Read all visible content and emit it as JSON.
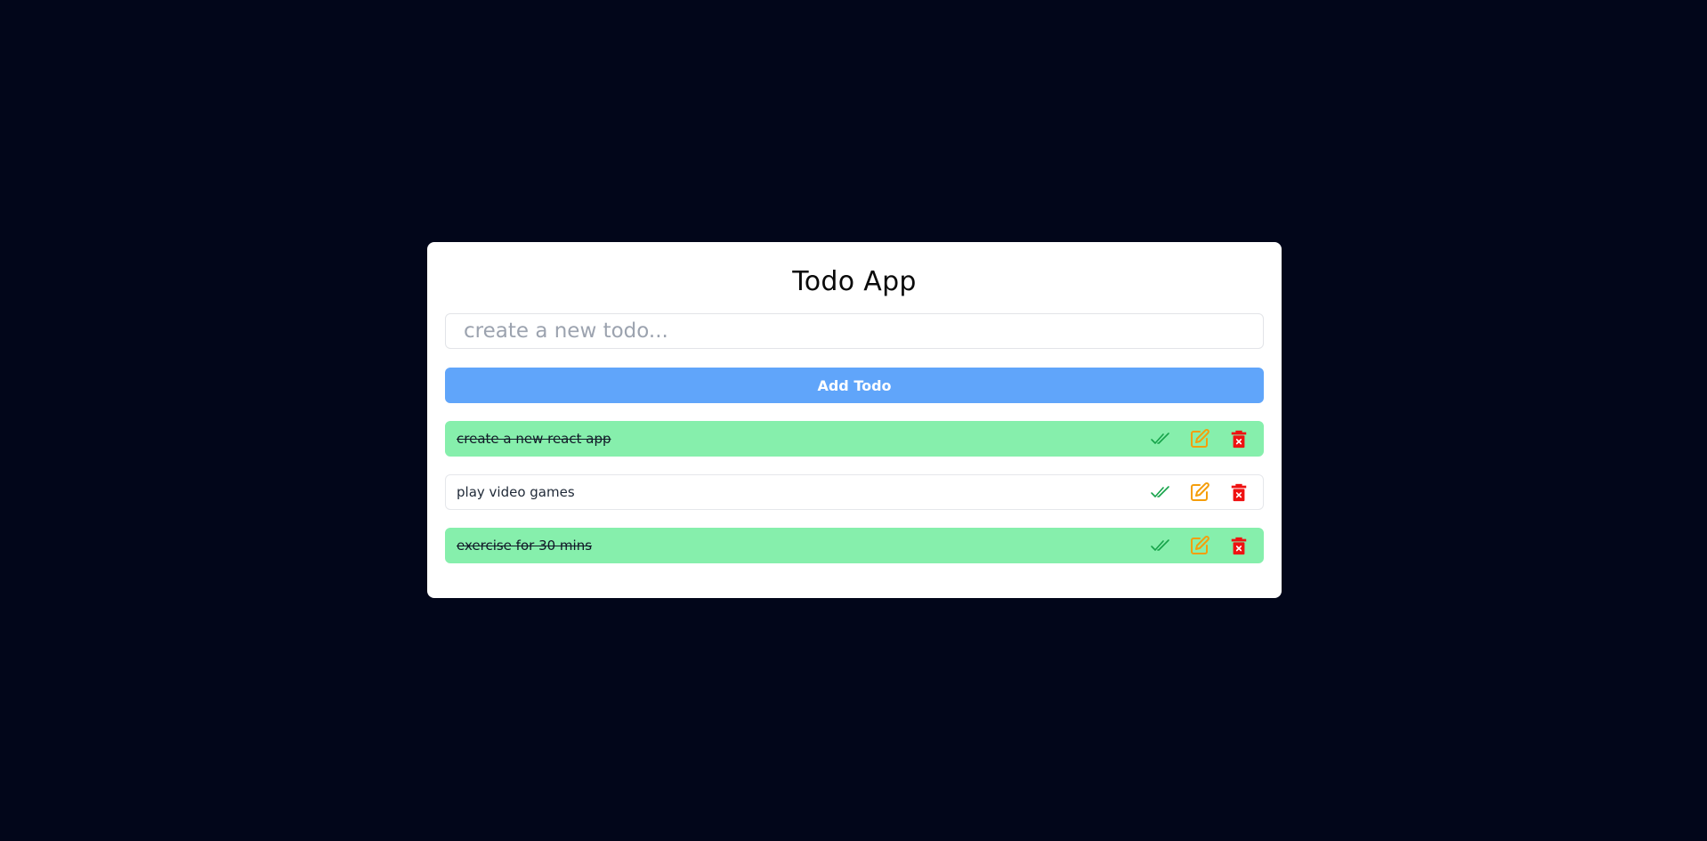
{
  "app": {
    "title": "Todo App"
  },
  "input": {
    "value": "",
    "placeholder": "create a new todo..."
  },
  "add_button": {
    "label": "Add Todo"
  },
  "todos": [
    {
      "text": "create a new react app",
      "completed": true
    },
    {
      "text": "play video games",
      "completed": false
    },
    {
      "text": "exercise for 30 mins",
      "completed": true
    }
  ],
  "icons": {
    "complete": "double-check-icon",
    "edit": "edit-icon",
    "delete": "trash-icon"
  },
  "colors": {
    "background": "#02061a",
    "card": "#ffffff",
    "accent": "#60a5fa",
    "completed_row": "#86efac",
    "check": "#16a34a",
    "edit": "#f59e0b",
    "delete": "#ef1111"
  }
}
